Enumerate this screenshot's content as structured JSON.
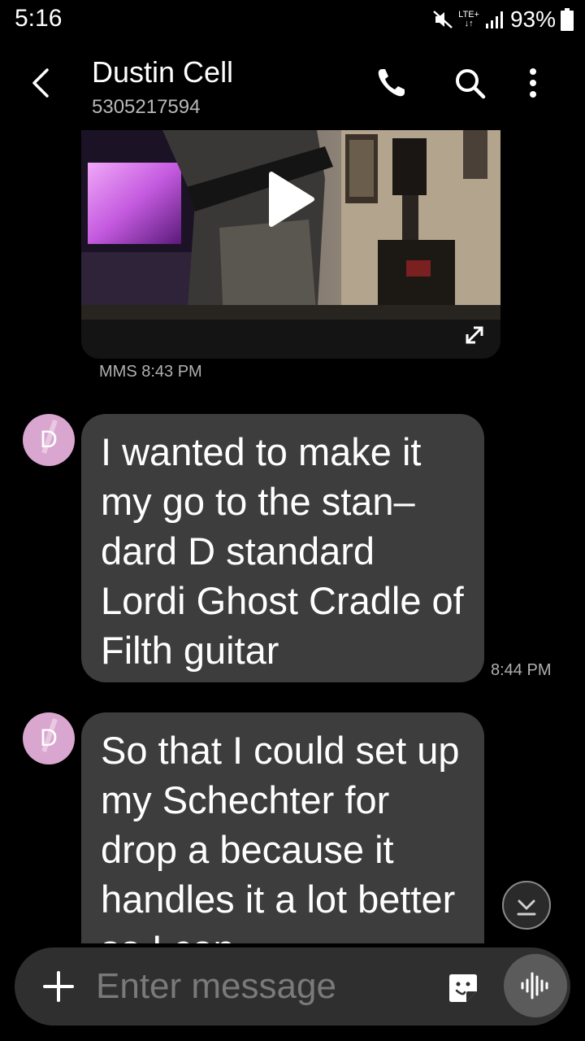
{
  "status_bar": {
    "time": "5:16",
    "network": "LTE+",
    "battery": "93%"
  },
  "header": {
    "contact_name": "Dustin Cell",
    "contact_number": "5305217594",
    "icons": [
      "back-arrow-icon",
      "phone-icon",
      "search-icon",
      "more-vert-icon"
    ]
  },
  "messages": [
    {
      "type": "video",
      "meta": "MMS 8:43 PM",
      "icons": [
        "play-icon",
        "expand-icon"
      ]
    },
    {
      "type": "text",
      "avatar_letter": "D",
      "text": "I wanted to make it my go to the stan–dard D standard Lordi Ghost Cradle of Filth guitar",
      "time": "8:44 PM"
    },
    {
      "type": "text",
      "avatar_letter": "D",
      "text": "So that I could set up my Schechter for drop a because it handles it a lot better so I can",
      "time": ""
    }
  ],
  "composer": {
    "placeholder": "Enter message",
    "value": "",
    "icons": [
      "plus-icon",
      "sticker-icon",
      "voice-wave-icon",
      "scroll-down-icon"
    ]
  },
  "colors": {
    "background": "#000000",
    "bubble": "#3d3d3d",
    "avatar": "#d9a6cf",
    "composer": "#2f2f2f",
    "secondary_text": "#b0b0b0"
  }
}
